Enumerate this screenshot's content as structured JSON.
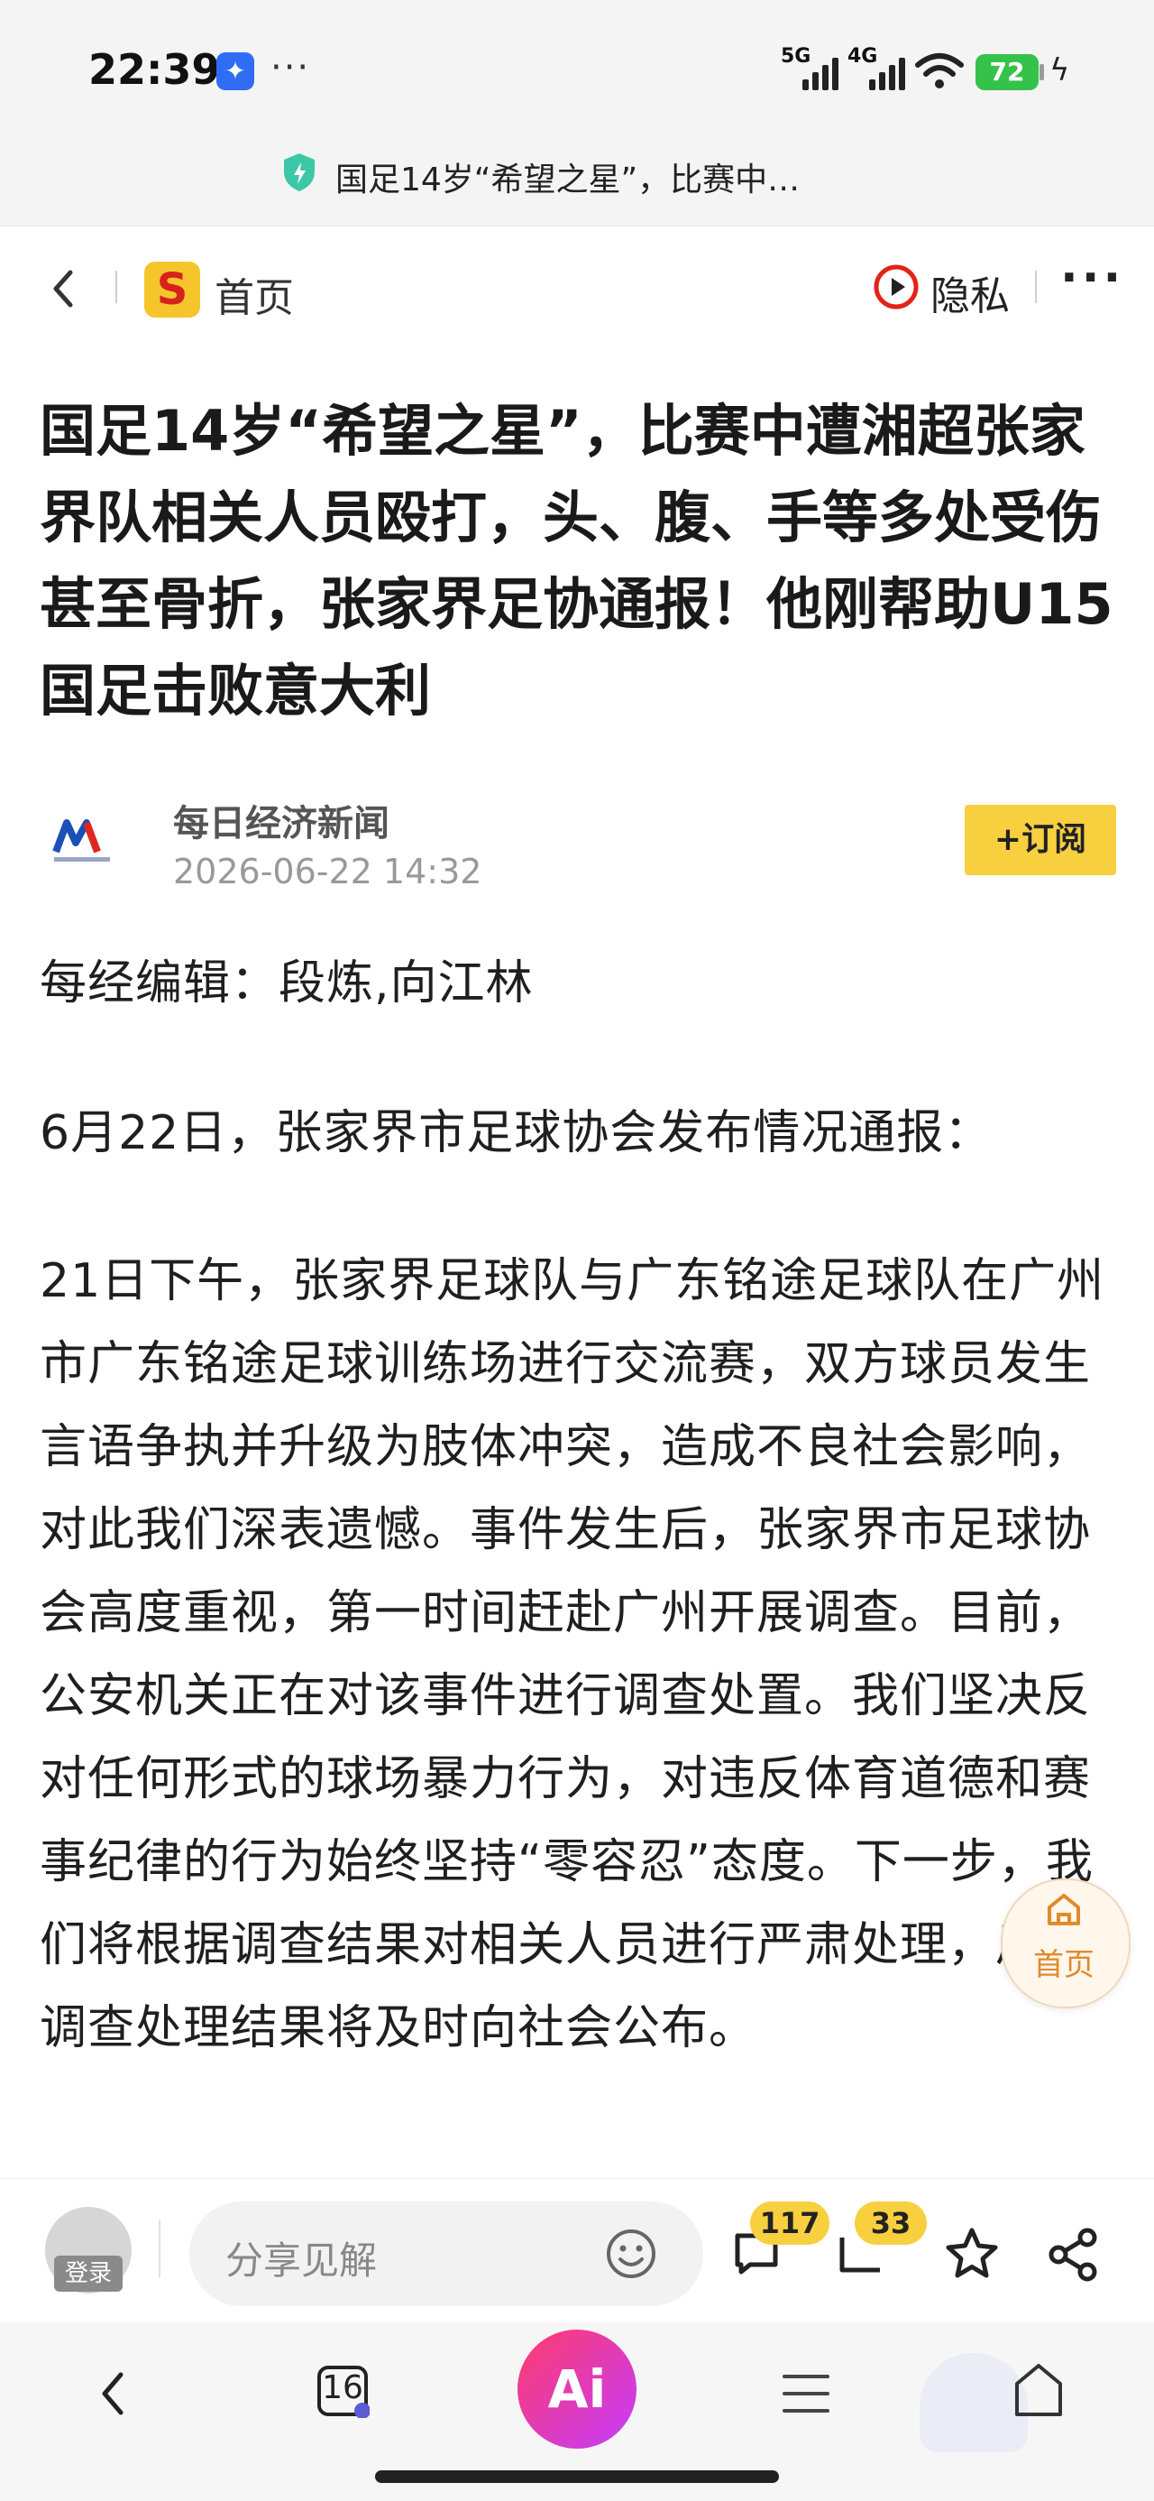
{
  "status": {
    "time": "22:39",
    "more": "···",
    "net1": "5G",
    "net2": "4G",
    "battery": "72"
  },
  "page_title": "国足14岁“希望之星”，比赛中…",
  "nav": {
    "home": "首页",
    "privacy": "隐私",
    "more": "···"
  },
  "headline": "国足14岁“希望之星”，比赛中遭湘超张家界队相关人员殴打，头、腹、手等多处受伤甚至骨折，张家界足协通报！他刚帮助U15国足击败意大利",
  "source": {
    "name": "每日经济新闻",
    "date": "2026-06-22 14:32",
    "subscribe": "+订阅"
  },
  "body": {
    "editor": "每经编辑：段炼,向江林",
    "p1": "6月22日，张家界市足球协会发布情况通报：",
    "p2": "21日下午，张家界足球队与广东铭途足球队在广州市广东铭途足球训练场进行交流赛，双方球员发生言语争执并升级为肢体冲突，造成不良社会影响，对此我们深表遗憾。事件发生后，张家界市足球协会高度重视，第一时间赶赴广州开展调查。目前，公安机关正在对该事件进行调查处置。我们坚决反对任何形式的球场暴力行为，对违反体育道德和赛事纪律的行为始终坚持“零容忍”态度。下一步，我们将根据调查结果对相关人员进行严肃处理，后续调查处理结果将及时向社会公布。"
  },
  "float_home": "首页",
  "comment_bar": {
    "avatar_label": "登录",
    "placeholder": "分享见解",
    "comments": "117",
    "favorites": "33"
  },
  "bottom_nav": {
    "tabs_count": "16",
    "ai": "Ai"
  },
  "colors": {
    "accent_yellow": "#f7cf3f",
    "battery_green": "#35c24a",
    "home_orange": "#e08a2c"
  }
}
